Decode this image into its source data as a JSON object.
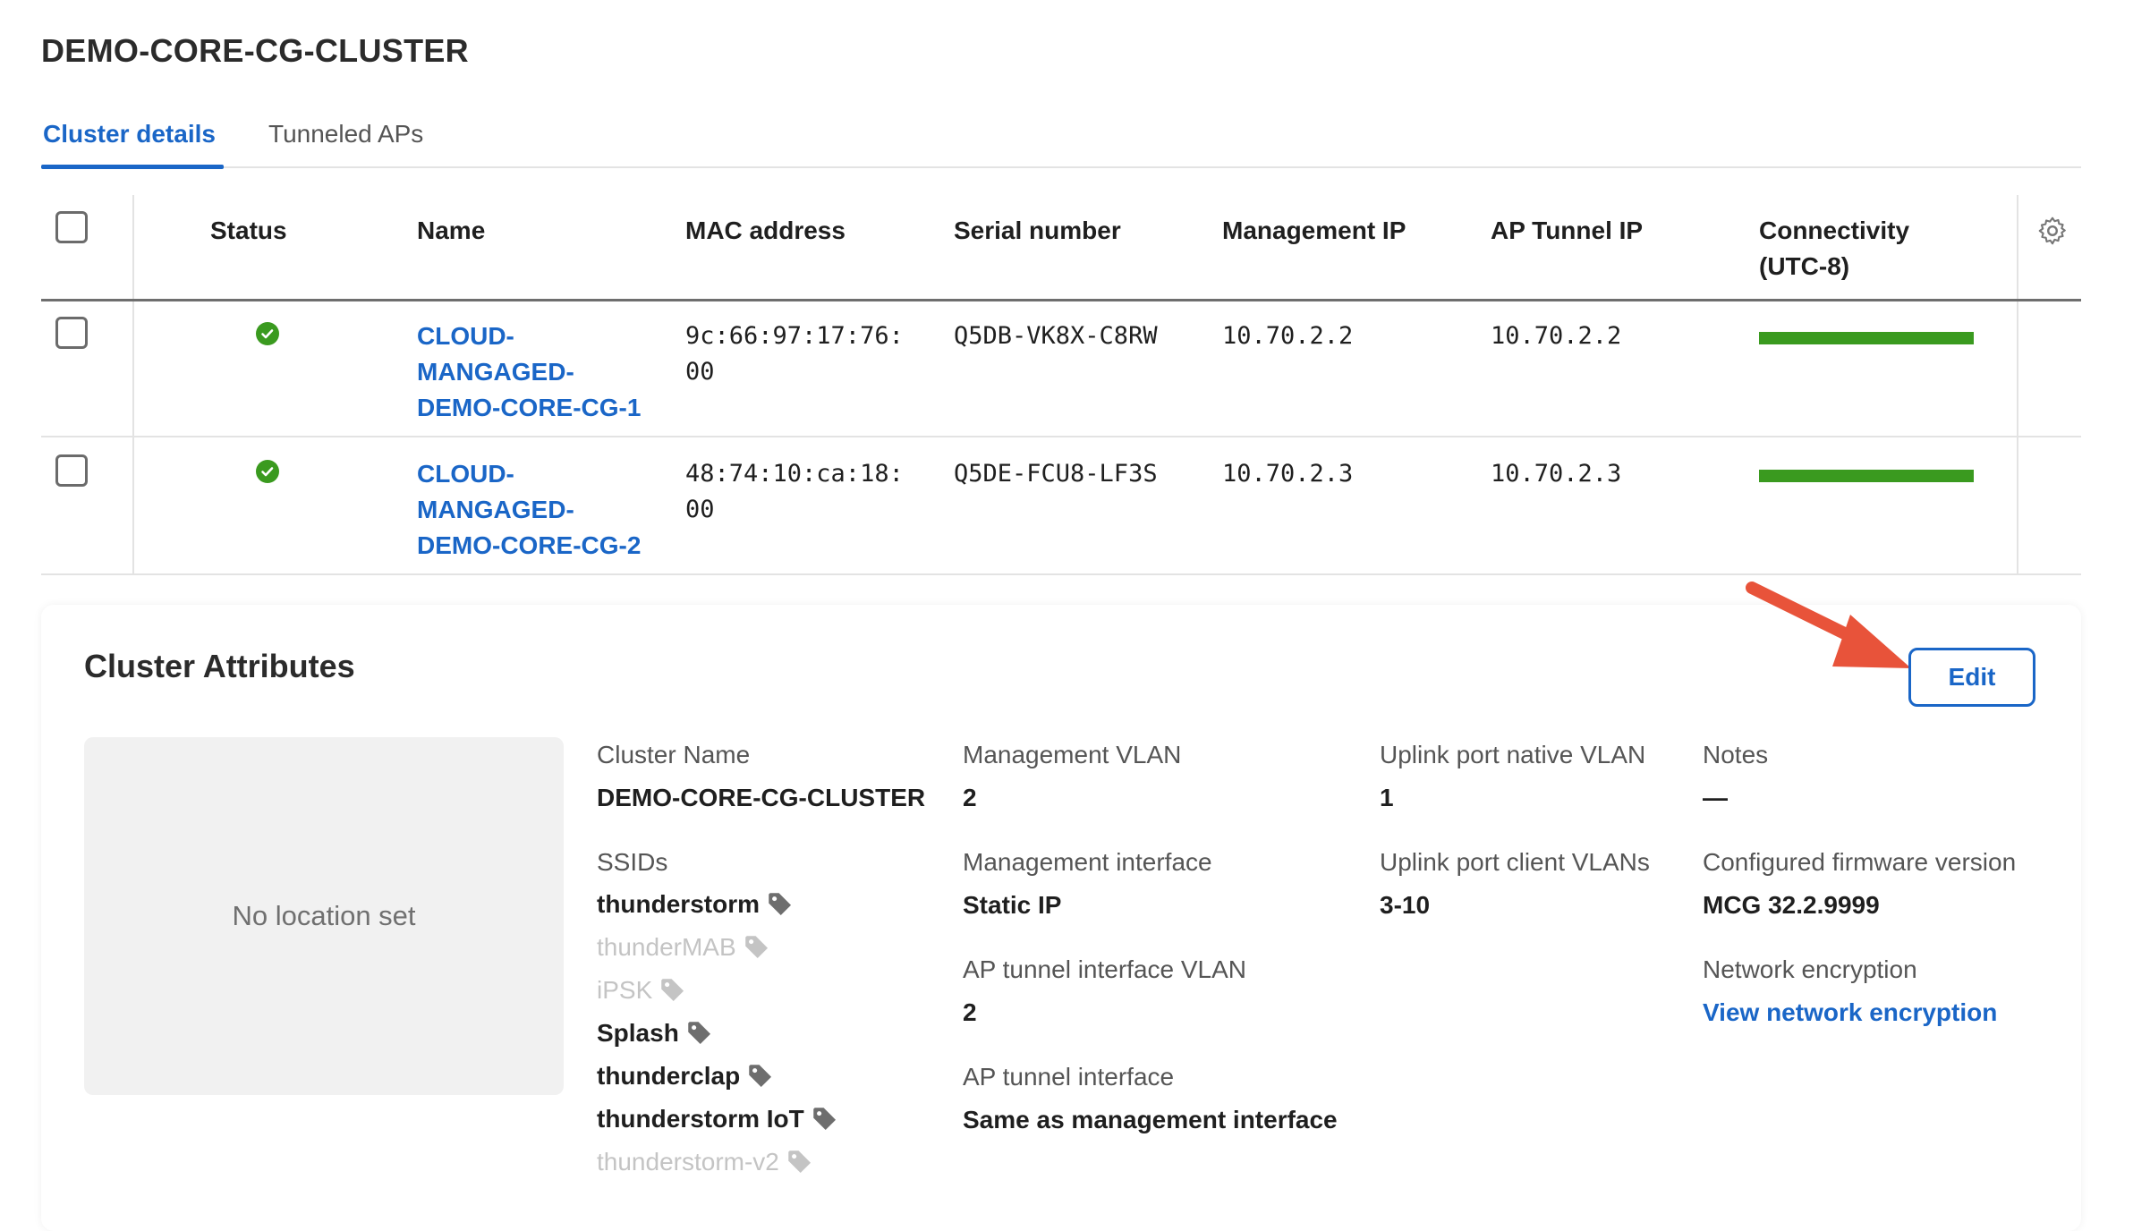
{
  "page": {
    "title": "DEMO-CORE-CG-CLUSTER"
  },
  "tabs": [
    {
      "label": "Cluster details",
      "active": true
    },
    {
      "label": "Tunneled APs",
      "active": false
    }
  ],
  "table": {
    "headers": {
      "status": "Status",
      "name": "Name",
      "mac": "MAC address",
      "serial": "Serial number",
      "mgmt_ip": "Management IP",
      "tunnel_ip": "AP Tunnel IP",
      "connectivity_1": "Connectivity",
      "connectivity_2": "(UTC-8)"
    },
    "rows": [
      {
        "name_1": "CLOUD-",
        "name_2": "MANGAGED-",
        "name_3": "DEMO-CORE-CG-1",
        "mac_1": "9c:66:97:17:76:",
        "mac_2": "00",
        "serial": "Q5DB-VK8X-C8RW",
        "mgmt_ip": "10.70.2.2",
        "tunnel_ip": "10.70.2.2",
        "status_color": "#3a9a1f"
      },
      {
        "name_1": "CLOUD-",
        "name_2": "MANGAGED-",
        "name_3": "DEMO-CORE-CG-2",
        "mac_1": "48:74:10:ca:18:",
        "mac_2": "00",
        "serial": "Q5DE-FCU8-LF3S",
        "mgmt_ip": "10.70.2.3",
        "tunnel_ip": "10.70.2.3",
        "status_color": "#3a9a1f"
      }
    ]
  },
  "attributes": {
    "title": "Cluster Attributes",
    "edit_label": "Edit",
    "no_location": "No location set",
    "cluster_name_label": "Cluster Name",
    "cluster_name_value": "DEMO-CORE-CG-CLUSTER",
    "ssids_label": "SSIDs",
    "ssids": [
      {
        "name": "thunderstorm",
        "enabled": true
      },
      {
        "name": "thunderMAB",
        "enabled": false
      },
      {
        "name": "iPSK",
        "enabled": false
      },
      {
        "name": "Splash",
        "enabled": true
      },
      {
        "name": "thunderclap",
        "enabled": true
      },
      {
        "name": "thunderstorm IoT",
        "enabled": true
      },
      {
        "name": "thunderstorm-v2",
        "enabled": false
      }
    ],
    "mgmt_vlan_label": "Management VLAN",
    "mgmt_vlan_value": "2",
    "mgmt_iface_label": "Management interface",
    "mgmt_iface_value": "Static IP",
    "ap_tunnel_vlan_label": "AP tunnel interface VLAN",
    "ap_tunnel_vlan_value": "2",
    "ap_tunnel_iface_label": "AP tunnel interface",
    "ap_tunnel_iface_value": "Same as management interface",
    "uplink_native_label": "Uplink port native VLAN",
    "uplink_native_value": "1",
    "uplink_client_label": "Uplink port client VLANs",
    "uplink_client_value": "3-10",
    "notes_label": "Notes",
    "notes_value": "—",
    "firmware_label": "Configured firmware version",
    "firmware_value": "MCG 32.2.9999",
    "encryption_label": "Network encryption",
    "encryption_link": "View network encryption"
  },
  "colors": {
    "accent": "#1a66c7",
    "status_ok": "#3a9a1f",
    "annotation_arrow": "#e8533a"
  },
  "icons": {
    "status": "check-circle-icon",
    "settings": "gear-icon",
    "tag": "tag-icon"
  }
}
